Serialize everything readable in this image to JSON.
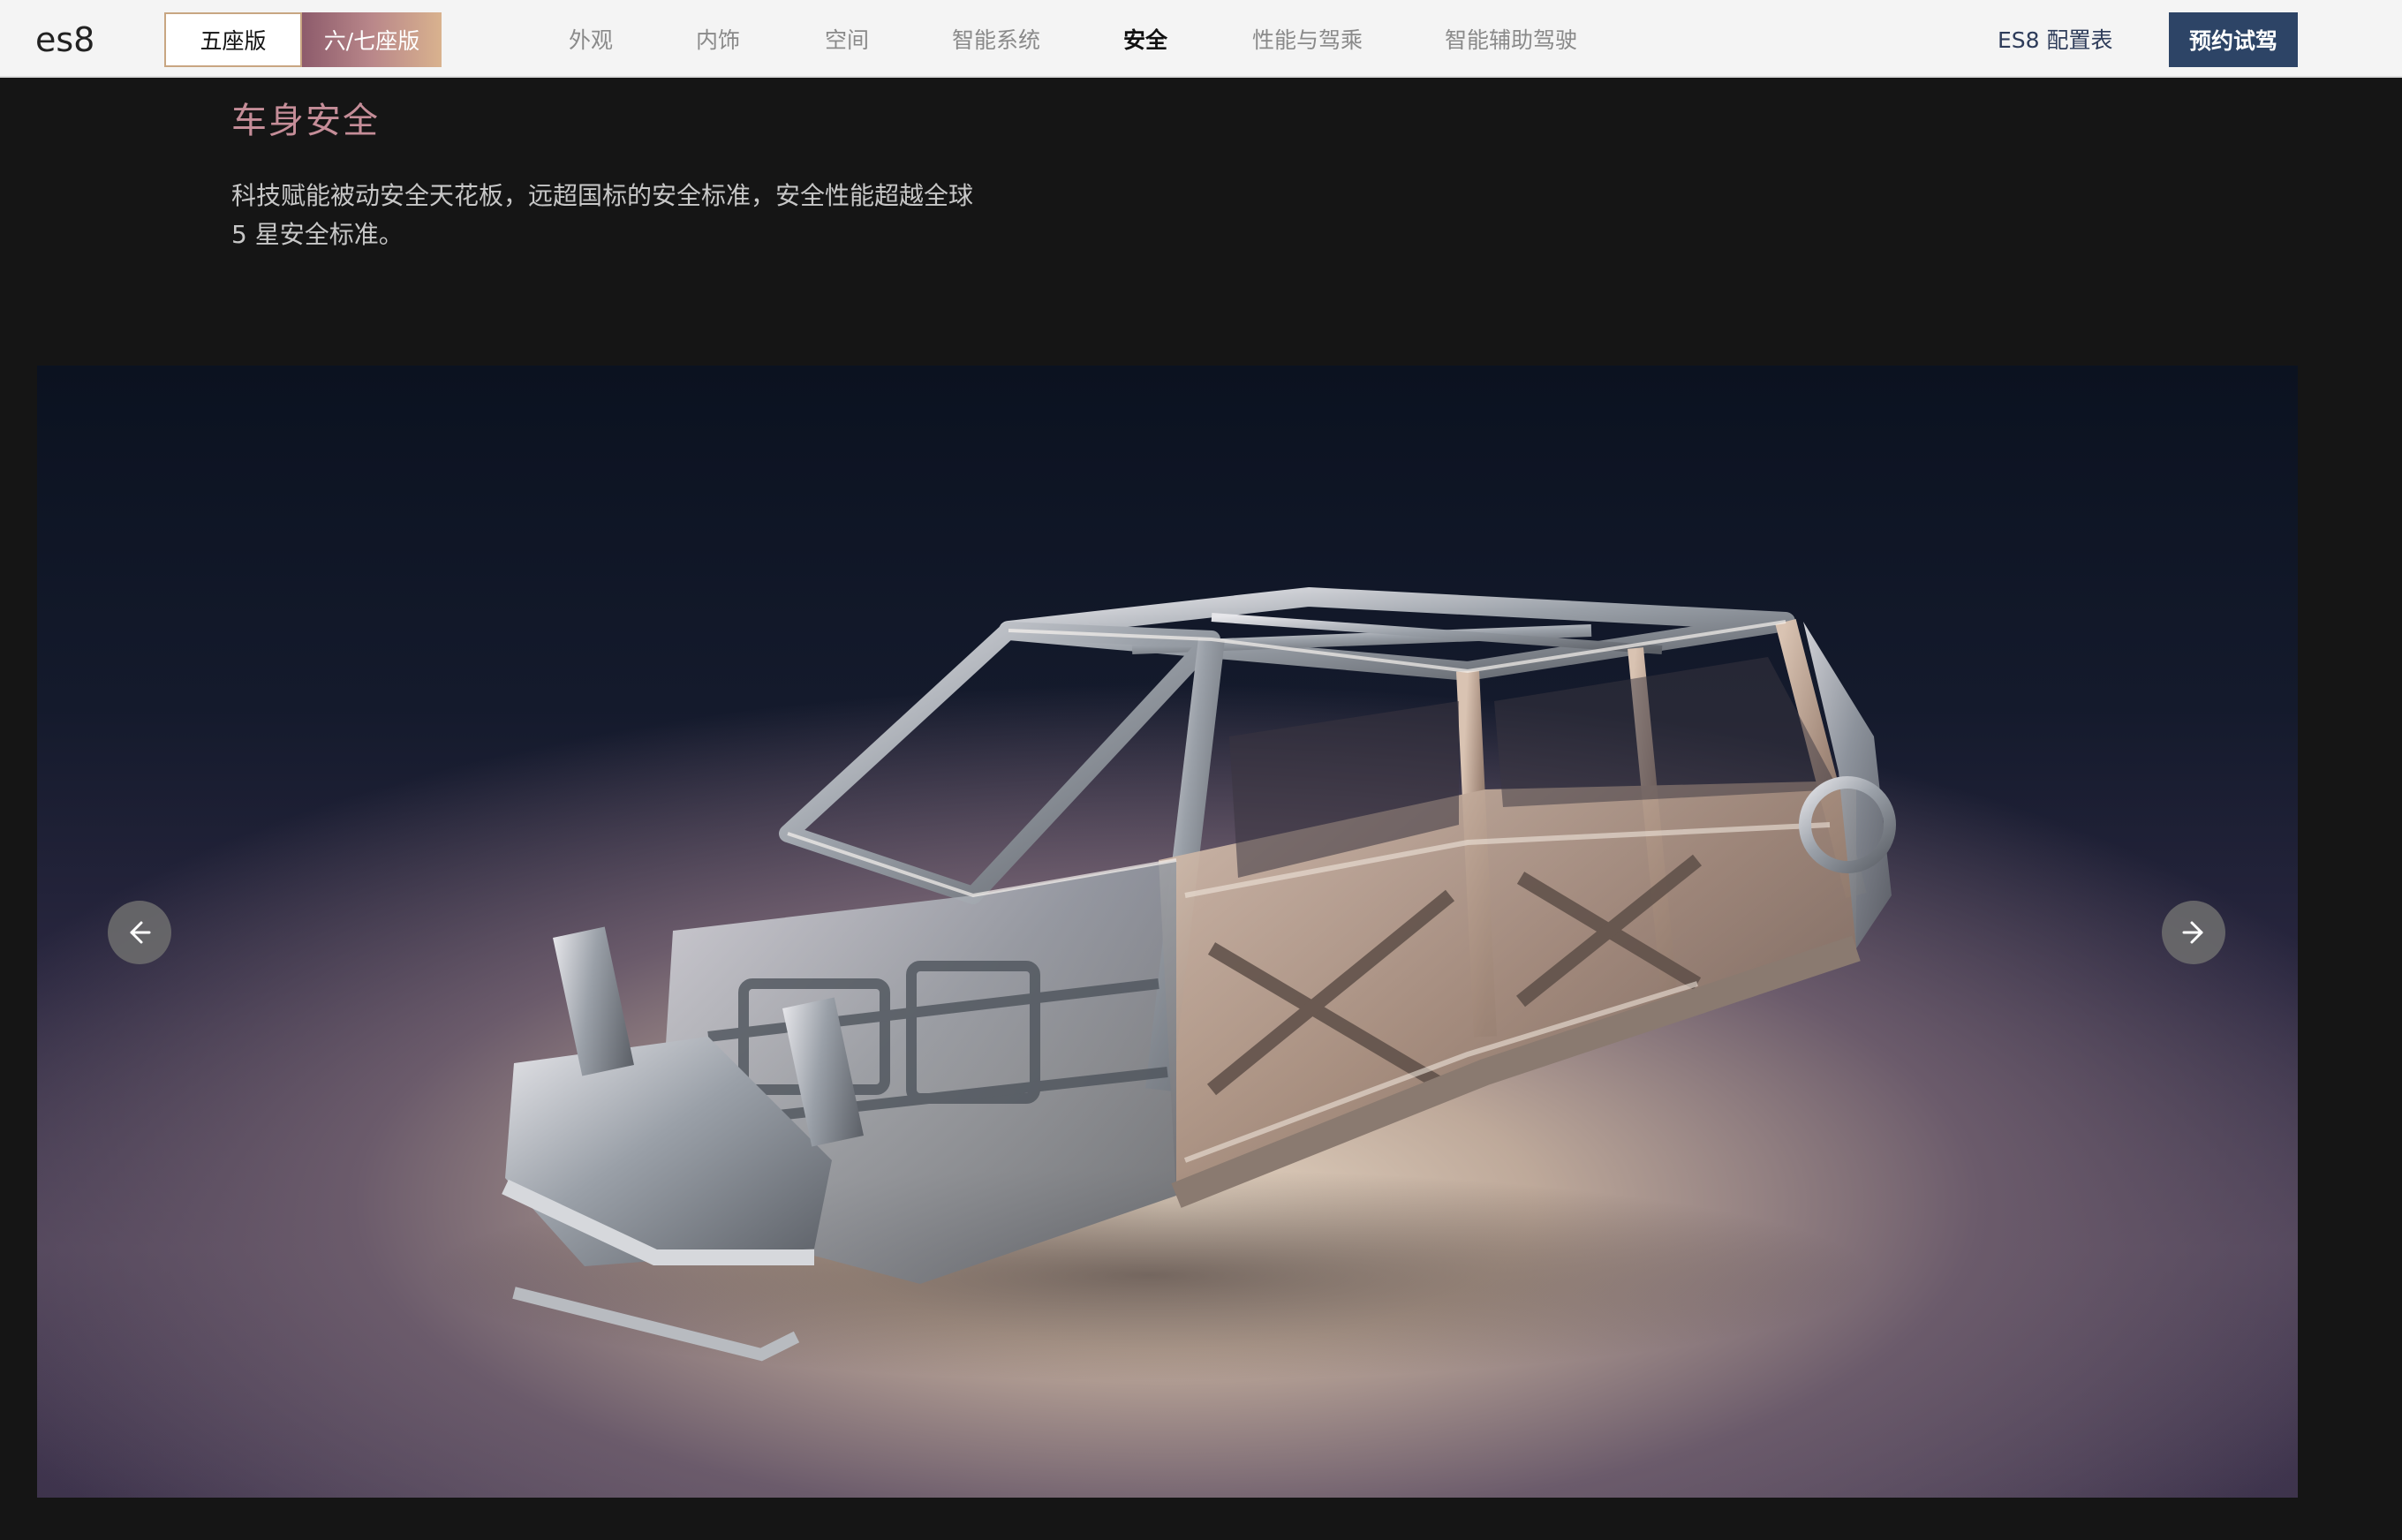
{
  "header": {
    "logo_text": "es8",
    "variants": [
      {
        "label": "五座版",
        "selected": true
      },
      {
        "label": "六/七座版",
        "selected": false
      }
    ],
    "nav": [
      {
        "label": "外观",
        "active": false
      },
      {
        "label": "内饰",
        "active": false
      },
      {
        "label": "空间",
        "active": false
      },
      {
        "label": "智能系统",
        "active": false
      },
      {
        "label": "安全",
        "active": true
      },
      {
        "label": "性能与驾乘",
        "active": false
      },
      {
        "label": "智能辅助驾驶",
        "active": false
      }
    ],
    "config_label": "ES8 配置表",
    "cta_label": "预约试驾"
  },
  "section": {
    "title": "车身安全",
    "description": "科技赋能被动安全天花板，远超国标的安全标准，安全性能超越全球 5 星安全标准。"
  },
  "stage": {
    "image_alt": "car-body-frame",
    "caption": "",
    "prev_icon": "arrow-left-icon",
    "next_icon": "arrow-right-icon"
  },
  "colors": {
    "accent_title": "#c58d98",
    "cta_background": "#2d4466",
    "variant_gradient_start": "#8d5b6b",
    "variant_gradient_end": "#d9b28e",
    "page_background": "#151515"
  }
}
